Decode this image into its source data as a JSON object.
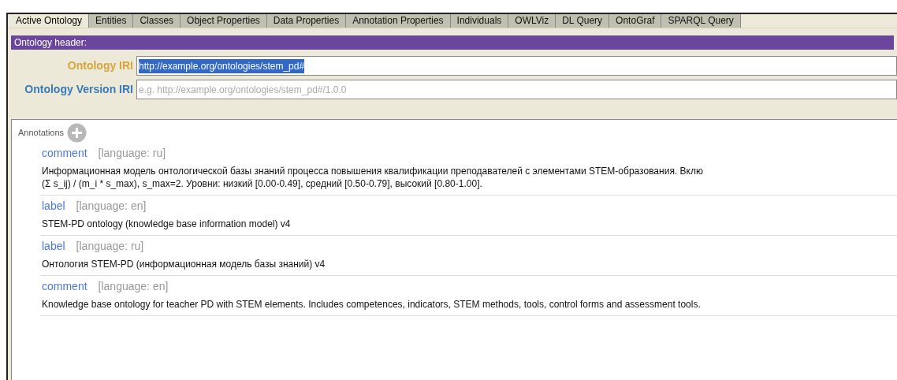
{
  "tabs": [
    {
      "label": "Active Ontology",
      "selected": true
    },
    {
      "label": "Entities",
      "selected": false
    },
    {
      "label": "Classes",
      "selected": false
    },
    {
      "label": "Object Properties",
      "selected": false
    },
    {
      "label": "Data Properties",
      "selected": false
    },
    {
      "label": "Annotation Properties",
      "selected": false
    },
    {
      "label": "Individuals",
      "selected": false
    },
    {
      "label": "OWLViz",
      "selected": false
    },
    {
      "label": "DL Query",
      "selected": false
    },
    {
      "label": "OntoGraf",
      "selected": false
    },
    {
      "label": "SPARQL Query",
      "selected": false
    }
  ],
  "header": {
    "title": "Ontology header:"
  },
  "fields": [
    {
      "label": "Ontology IRI",
      "value": "http://example.org/ontologies/stem_pd#",
      "selected": true
    },
    {
      "label": "Ontology Version IRI",
      "placeholder": "e.g. http://example.org/ontologies/stem_pd#/1.0.0",
      "selected": false
    }
  ],
  "annotations": {
    "title": "Annotations",
    "items": [
      {
        "property": "comment",
        "language": "[language: ru]",
        "lines": [
          "Информационная модель онтологической базы знаний процесса повышения квалификации преподавателей с элементами STEM-образования. Вклю",
          "(Σ s_ij) / (m_i * s_max), s_max=2. Уровни: низкий [0.00-0.49], средний [0.50-0.79], высокий [0.80-1.00]."
        ]
      },
      {
        "property": "label",
        "language": "[language: en]",
        "lines": [
          "STEM-PD ontology (knowledge base information model) v4"
        ]
      },
      {
        "property": "label",
        "language": "[language: ru]",
        "lines": [
          "Онтология STEM-PD (информационная модель базы знаний) v4"
        ]
      },
      {
        "property": "comment",
        "language": "[language: en]",
        "lines": [
          "Knowledge base ontology for teacher PD with STEM elements. Includes competences, indicators, STEM methods, tools, control forms and assessment tools."
        ]
      }
    ]
  }
}
